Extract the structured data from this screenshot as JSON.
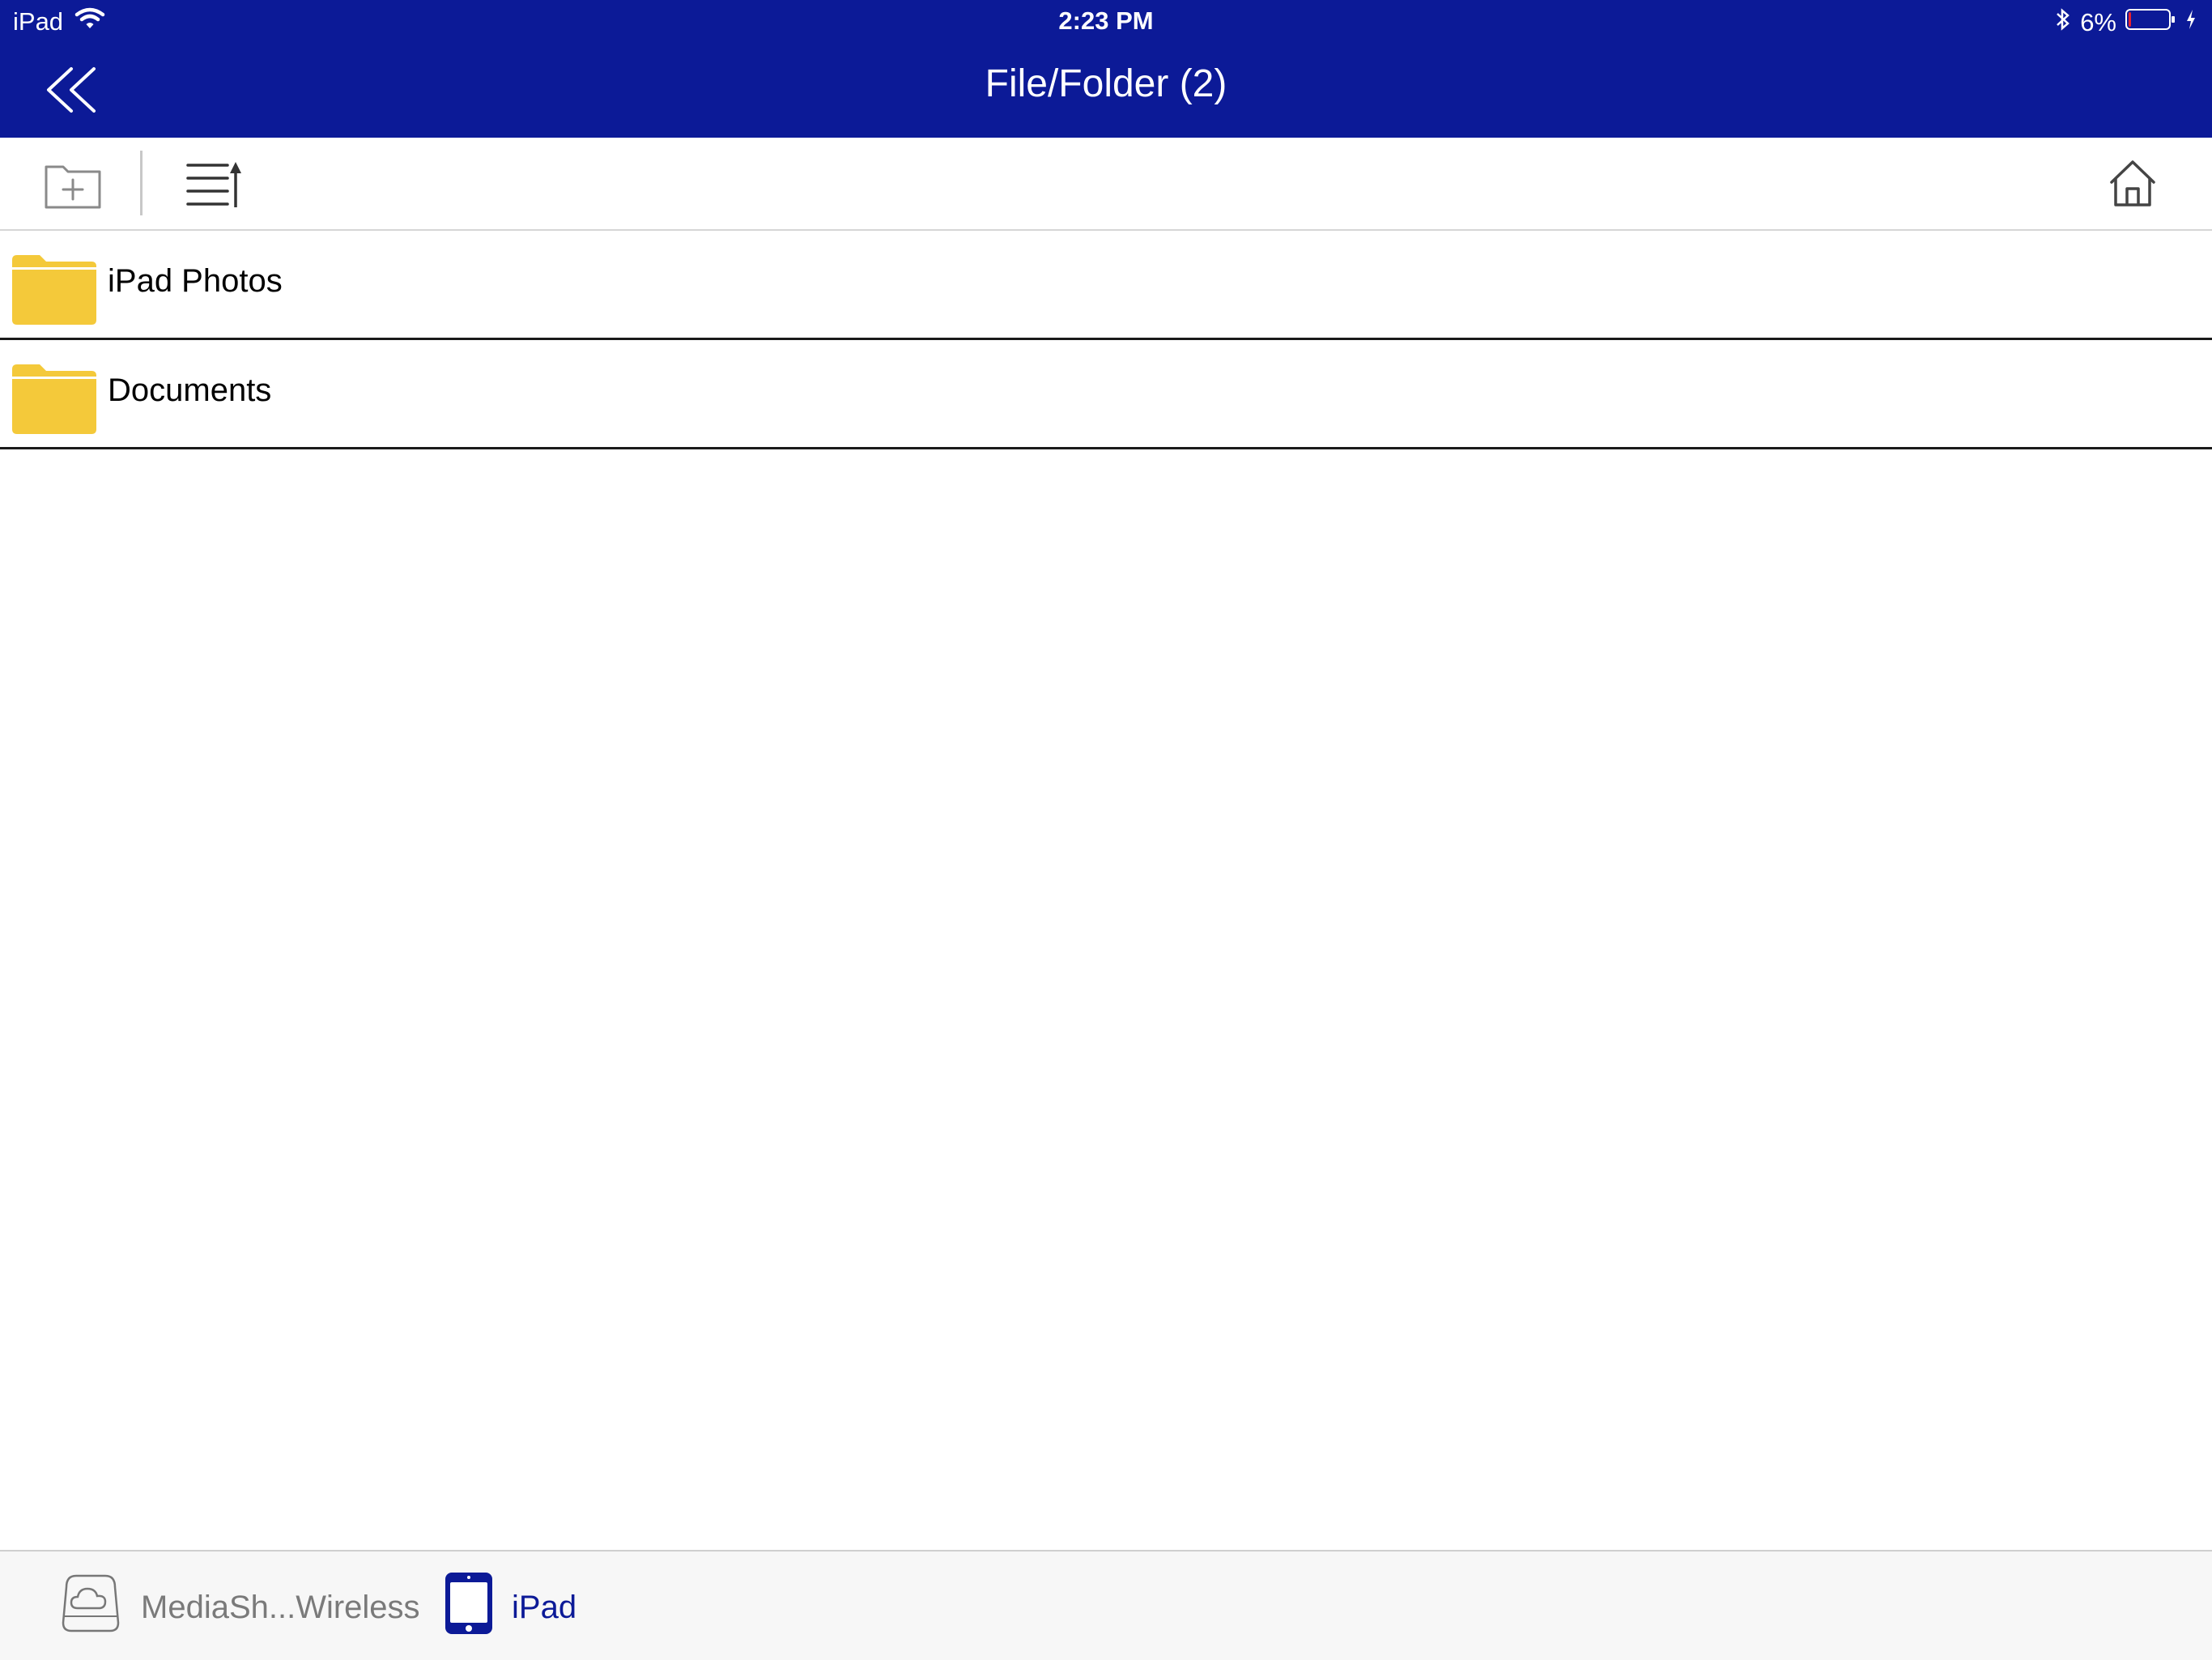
{
  "colors": {
    "nav_background": "#0c1a97",
    "folder": "#f4c93a",
    "active_tab": "#0c1a97",
    "inactive_tab": "#7a7a7a",
    "battery_low": "#e8212f"
  },
  "status_bar": {
    "carrier": "iPad",
    "time": "2:23 PM",
    "battery_percent": "6%",
    "battery_level": 0.06,
    "icons": [
      "wifi-icon",
      "bluetooth-icon",
      "battery-icon",
      "charging-icon"
    ]
  },
  "nav": {
    "title": "File/Folder (2)",
    "back_icon": "double-chevron-left-icon"
  },
  "toolbar": {
    "icons": [
      "new-folder-icon",
      "sort-list-icon",
      "home-icon"
    ]
  },
  "files": [
    {
      "name": "iPad Photos",
      "type": "folder"
    },
    {
      "name": "Documents",
      "type": "folder"
    }
  ],
  "bottom_tabs": [
    {
      "label": "MediaSh...Wireless",
      "icon": "cloud-drive-icon",
      "active": false
    },
    {
      "label": "iPad",
      "icon": "ipad-icon",
      "active": true
    }
  ]
}
